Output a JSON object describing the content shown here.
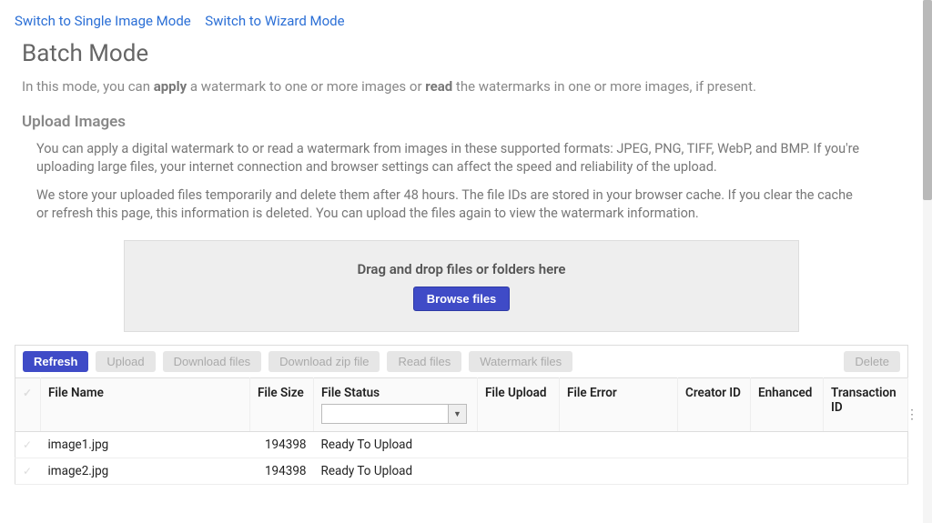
{
  "modeLinks": {
    "single": "Switch to Single Image Mode",
    "wizard": "Switch to Wizard Mode"
  },
  "title": "Batch Mode",
  "intro": {
    "pre": "In this mode, you can ",
    "b1": "apply",
    "mid": " a watermark to one or more images or ",
    "b2": "read",
    "post": " the watermarks in one or more images, if present."
  },
  "upload": {
    "heading": "Upload Images",
    "p1": "You can apply a digital watermark to or read a watermark from images in these supported formats: JPEG, PNG, TIFF, WebP, and BMP. If you're uploading large files, your internet connection and browser settings can affect the speed and reliability of the upload.",
    "p2": "We store your uploaded files temporarily and delete them after 48 hours. The file IDs are stored in your browser cache. If you clear the cache or refresh this page, this information is deleted. You can upload the files again to view the watermark information."
  },
  "dropzone": {
    "label": "Drag and drop files or folders here",
    "browse": "Browse files"
  },
  "toolbar": {
    "refresh": "Refresh",
    "upload": "Upload",
    "downloadFiles": "Download files",
    "downloadZip": "Download zip file",
    "readFiles": "Read files",
    "watermarkFiles": "Watermark files",
    "delete": "Delete"
  },
  "table": {
    "columns": {
      "fileName": "File Name",
      "fileSize": "File Size",
      "fileStatus": "File Status",
      "fileUpload": "File Upload",
      "fileError": "File Error",
      "creatorId": "Creator ID",
      "enhanced": "Enhanced",
      "transactionId": "Transaction ID"
    },
    "rows": [
      {
        "name": "image1.jpg",
        "size": "194398",
        "status": "Ready To Upload"
      },
      {
        "name": "image2.jpg",
        "size": "194398",
        "status": "Ready To Upload"
      }
    ]
  }
}
